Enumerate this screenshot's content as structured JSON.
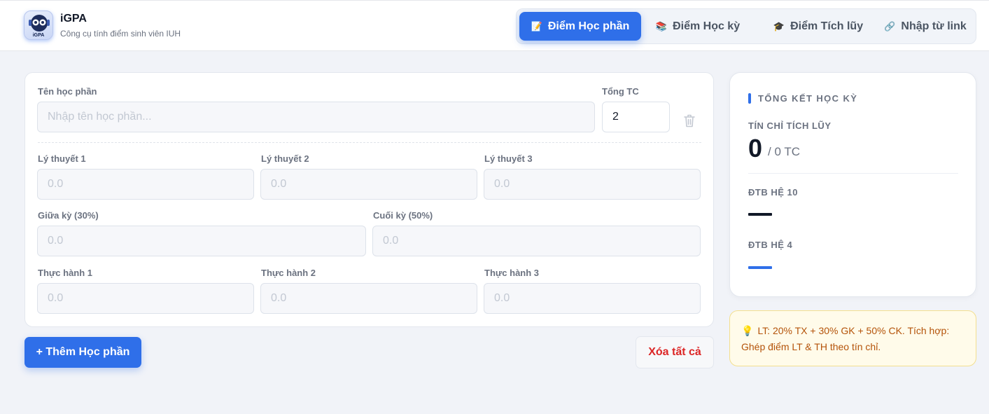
{
  "app": {
    "title": "iGPA",
    "subtitle": "Công cụ tính điểm sinh viên IUH",
    "logo_caption": "iGPA"
  },
  "nav": {
    "tabs": [
      {
        "label": "Điểm Học phần",
        "icon": "memo-icon",
        "active": true
      },
      {
        "label": "Điểm Học kỳ",
        "icon": "books-icon",
        "active": false
      },
      {
        "label": "Điểm Tích lũy",
        "icon": "graduation-cap-icon",
        "active": false
      },
      {
        "label": "Nhập từ link",
        "icon": "link-icon",
        "active": false
      }
    ]
  },
  "course": {
    "name_label": "Tên học phần",
    "name_placeholder": "Nhập tên học phần...",
    "credits_label": "Tổng TC",
    "credits_value": "2",
    "theory": [
      {
        "label": "Lý thuyết 1",
        "placeholder": "0.0"
      },
      {
        "label": "Lý thuyết 2",
        "placeholder": "0.0"
      },
      {
        "label": "Lý thuyết 3",
        "placeholder": "0.0"
      }
    ],
    "midterm": {
      "label": "Giữa kỳ (30%)",
      "placeholder": "0.0"
    },
    "final": {
      "label": "Cuối kỳ (50%)",
      "placeholder": "0.0"
    },
    "practice": [
      {
        "label": "Thực hành 1",
        "placeholder": "0.0"
      },
      {
        "label": "Thực hành 2",
        "placeholder": "0.0"
      },
      {
        "label": "Thực hành 3",
        "placeholder": "0.0"
      }
    ]
  },
  "actions": {
    "add_label": "+ Thêm Học phần",
    "clear_label": "Xóa tất cả"
  },
  "summary": {
    "title": "TỔNG KẾT HỌC KỲ",
    "credits_label": "TÍN CHỈ TÍCH LŨY",
    "credits_value": "0",
    "credits_total": "/ 0 TC",
    "gpa10_label": "ĐTB HỆ 10",
    "gpa4_label": "ĐTB HỆ 4"
  },
  "tip": {
    "icon": "lightbulb-icon",
    "text": "LT: 20% TX + 30% GK + 50% CK. Tích hợp: Ghép điểm LT & TH theo tín chỉ."
  },
  "colors": {
    "accent": "#2f6fe9",
    "danger": "#dc2626",
    "tip_text": "#b45309",
    "tip_bg": "#fffbea"
  }
}
